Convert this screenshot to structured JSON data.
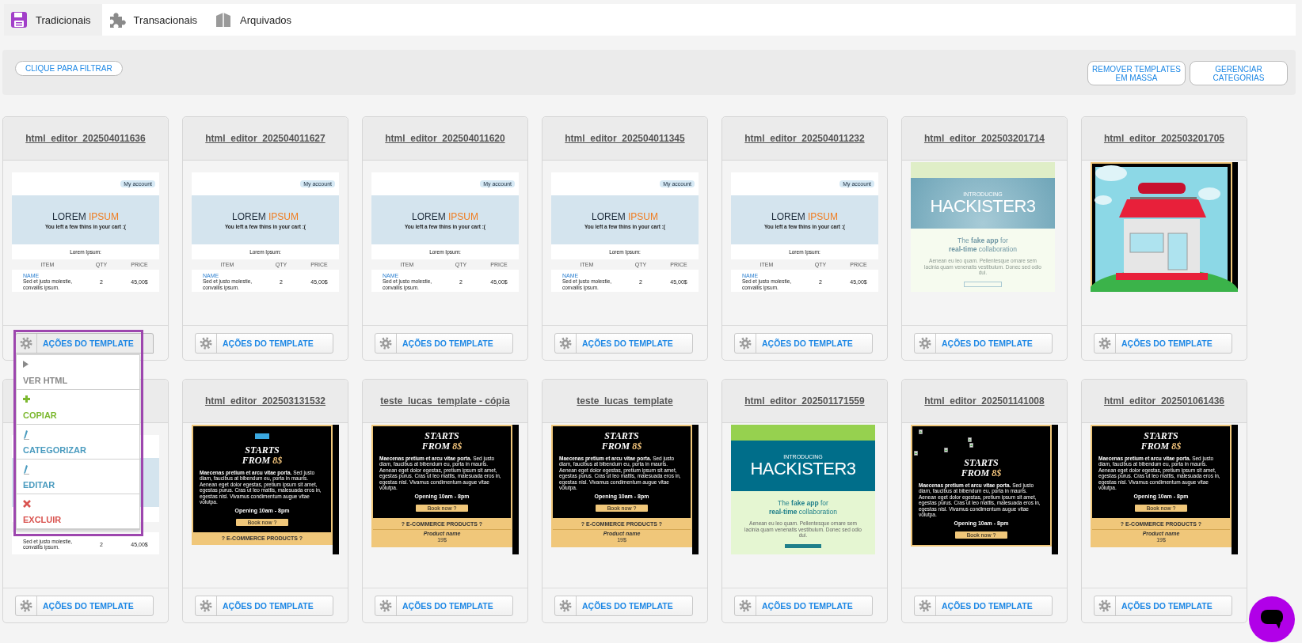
{
  "tabs": [
    {
      "label": "Tradicionais",
      "selected": true
    },
    {
      "label": "Transacionais",
      "selected": false
    },
    {
      "label": "Arquivados",
      "selected": false
    }
  ],
  "toolbar": {
    "filter_button": "CLIQUE PARA FILTRAR",
    "buttons": [
      "REMOVER TEMPLATES EM MASSA",
      "GERENCIAR CATEGORIAS"
    ]
  },
  "templates": [
    {
      "title": "html_editor_202504011636",
      "action": "AÇÕES DO TEMPLATE",
      "menu_expanded": true,
      "preview": {
        "kind": "cart",
        "account": "My account",
        "title": "LOREM",
        "title_accent": "IPSUM",
        "subtitle": "You left a few thins in your cart :(",
        "section": "Lorem Ipsum:",
        "columns": [
          "ITEM",
          "QTY",
          "PRICE"
        ],
        "item_name": "NAME",
        "item_desc": "Sed et justo molestie, convallis ipsum.",
        "qty": "2",
        "price": "45,00$"
      }
    },
    {
      "title": "html_editor_202504011627",
      "action": "AÇÕES DO TEMPLATE",
      "menu_expanded": false,
      "preview": {
        "kind": "cart",
        "account": "My account",
        "title": "LOREM",
        "title_accent": "IPSUM",
        "subtitle": "You left a few thins in your cart :(",
        "section": "Lorem Ipsum:",
        "columns": [
          "ITEM",
          "QTY",
          "PRICE"
        ],
        "item_name": "NAME",
        "item_desc": "Sed et justo molestie, convallis ipsum.",
        "qty": "2",
        "price": "45,00$"
      }
    },
    {
      "title": "html_editor_202504011620",
      "action": "AÇÕES DO TEMPLATE",
      "menu_expanded": false,
      "preview": {
        "kind": "cart",
        "account": "My account",
        "title": "LOREM",
        "title_accent": "IPSUM",
        "subtitle": "You left a few thins in your cart :(",
        "section": "Lorem Ipsum:",
        "columns": [
          "ITEM",
          "QTY",
          "PRICE"
        ],
        "item_name": "NAME",
        "item_desc": "Sed et justo molestie, convallis ipsum.",
        "qty": "2",
        "price": "45,00$"
      }
    },
    {
      "title": "html_editor_202504011345",
      "action": "AÇÕES DO TEMPLATE",
      "menu_expanded": false,
      "preview": {
        "kind": "cart",
        "account": "My account",
        "title": "LOREM",
        "title_accent": "IPSUM",
        "subtitle": "You left a few thins in your cart :(",
        "section": "Lorem Ipsum:",
        "columns": [
          "ITEM",
          "QTY",
          "PRICE"
        ],
        "item_name": "NAME",
        "item_desc": "Sed et justo molestie, convallis ipsum.",
        "qty": "2",
        "price": "45,00$"
      }
    },
    {
      "title": "html_editor_202504011232",
      "action": "AÇÕES DO TEMPLATE",
      "menu_expanded": false,
      "preview": {
        "kind": "cart",
        "account": "My account",
        "title": "LOREM",
        "title_accent": "IPSUM",
        "subtitle": "You left a few thins in your cart :(",
        "section": "Lorem Ipsum:",
        "columns": [
          "ITEM",
          "QTY",
          "PRICE"
        ],
        "item_name": "NAME",
        "item_desc": "Sed et justo molestie, convallis ipsum.",
        "qty": "2",
        "price": "45,00$"
      }
    },
    {
      "title": "html_editor_202503201714",
      "action": "AÇÕES DO TEMPLATE",
      "menu_expanded": false,
      "preview": {
        "kind": "hackister",
        "faded": true,
        "intro": "INTRODUCING",
        "name": "HACKISTER3",
        "tagline_1": "The **fake app** for",
        "tagline_2": "**real-time** collaboration",
        "body": "Aenean eu leo quam. Pellentesque ornare sem lacinia quam venenatis vestibulum. Donec sed odio dui."
      }
    },
    {
      "title": "html_editor_202503201705",
      "action": "AÇÕES DO TEMPLATE",
      "menu_expanded": false
    },
    {
      "action": "AÇÕES DO TEMPLATE",
      "menu_expanded": false,
      "preview": {
        "kind": "cart",
        "item_desc": "Sed et justo molestie, convallis ipsum.",
        "qty": "2",
        "price": "45,00$"
      }
    },
    {
      "title": "html_editor_202503131532",
      "action": "AÇÕES DO TEMPLATE",
      "menu_expanded": false,
      "preview": {
        "kind": "promo",
        "badge": true,
        "broken_images": false,
        "heading": "STARTS",
        "heading2": "FROM",
        "price": "8$",
        "body": "**Maecenas pretium et arcu vitae porta.** Sed justo diam, faucibus at bibendum eu, porta in mauris. Aenean eget dolor egestas, pretium ipsum sit amet, egestas purus. Cras ut leo mattis, malesuada eros in, egestas nisl. Vivamus condimentum augue vitae volutpa.",
        "hours": "Opening 10am - 8pm",
        "button": "Book now ?",
        "section": "? E-COMMERCE PRODUCTS ?"
      }
    },
    {
      "title": "teste_lucas_template - cópia",
      "action": "AÇÕES DO TEMPLATE",
      "menu_expanded": false,
      "preview": {
        "kind": "promo",
        "badge": false,
        "broken_images": false,
        "heading": "STARTS",
        "heading2": "FROM",
        "price": "8$",
        "body": "**Maecenas pretium et arcu vitae porta.** Sed justo diam, faucibus at bibendum eu, porta in mauris. Aenean eget dolor egestas, pretium ipsum sit amet, egestas purus. Cras ut leo mattis, malesuada eros in, egestas nisl. Vivamus condimentum augue vitae volutpa.",
        "hours": "Opening 10am - 8pm",
        "button": "Book now ?",
        "section": "? E-COMMERCE PRODUCTS ?",
        "product_name": "Product name",
        "product_price": "19$"
      }
    },
    {
      "title": "teste_lucas_template",
      "action": "AÇÕES DO TEMPLATE",
      "menu_expanded": false,
      "preview": {
        "kind": "promo",
        "badge": false,
        "broken_images": false,
        "heading": "STARTS",
        "heading2": "FROM",
        "price": "8$",
        "body": "**Maecenas pretium et arcu vitae porta.** Sed justo diam, faucibus at bibendum eu, porta in mauris. Aenean eget dolor egestas, pretium ipsum sit amet, egestas purus. Cras ut leo mattis, malesuada eros in, egestas nisl. Vivamus condimentum augue vitae volutpa.",
        "hours": "Opening 10am - 8pm",
        "button": "Book now ?",
        "section": "? E-COMMERCE PRODUCTS ?",
        "product_name": "Product name",
        "product_price": "19$"
      }
    },
    {
      "title": "html_editor_202501171559",
      "action": "AÇÕES DO TEMPLATE",
      "menu_expanded": false,
      "preview": {
        "kind": "hackister",
        "faded": false,
        "intro": "INTRODUCING",
        "name": "HACKISTER3",
        "tagline_1": "The **fake app** for",
        "tagline_2": "**real-time** collaboration",
        "body": "Aenean eu leo quam. Pellentesque ornare sem lacinia quam venenatis vestibulum. Donec sed odio dui."
      }
    },
    {
      "title": "html_editor_202501141008",
      "action": "AÇÕES DO TEMPLATE",
      "menu_expanded": false,
      "preview": {
        "kind": "promo",
        "badge": false,
        "broken_images": true,
        "heading": "STARTS",
        "heading2": "FROM",
        "price": "8$",
        "body": "**Maecenas pretium et arcu vitae porta.** Sed justo diam, faucibus at bibendum eu, porta in mauris. Aenean eget dolor egestas, pretium ipsum sit amet, egestas purus. Cras ut leo mattis, malesuada eros in, egestas nisl. Vivamus condimentum augue vitae volutpa.",
        "hours": "Opening 10am - 8pm",
        "button": "Book now ?"
      }
    },
    {
      "title": "html_editor_202501061436",
      "action": "AÇÕES DO TEMPLATE",
      "menu_expanded": false,
      "preview": {
        "kind": "promo",
        "badge": false,
        "broken_images": false,
        "heading": "STARTS",
        "heading2": "FROM",
        "price": "8$",
        "body": "**Maecenas pretium et arcu vitae porta.** Sed justo diam, faucibus at bibendum eu, porta in mauris. Aenean eget dolor egestas, pretium ipsum sit amet, egestas purus. Cras ut leo mattis, malesuada eros in, egestas nisl. Vivamus condimentum augue vitae volutpa.",
        "hours": "Opening 10am - 8pm",
        "button": "Book now ?",
        "section": "? E-COMMERCE PRODUCTS ?",
        "product_name": "Product name",
        "product_price": "19$"
      }
    }
  ],
  "action_menu": {
    "highlighted": true,
    "items": [
      {
        "label": "VER HTML",
        "kind": "view",
        "color": "#8a8a8a"
      },
      {
        "label": "COPIAR",
        "kind": "copy",
        "color": "#7cb82f"
      },
      {
        "label": "CATEGORIZAR",
        "kind": "categorize",
        "color": "#4a9bbf"
      },
      {
        "label": "EDITAR",
        "kind": "edit",
        "color": "#4a9bbf"
      },
      {
        "label": "EXCLUIR",
        "kind": "delete",
        "color": "#d9534f"
      }
    ]
  },
  "chat": {
    "open": false
  }
}
